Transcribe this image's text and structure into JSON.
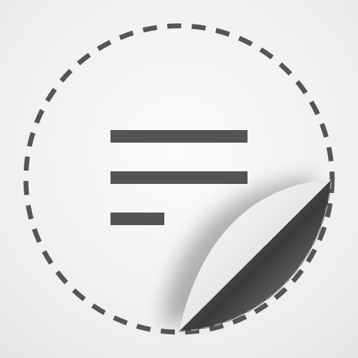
{
  "app_icon": {
    "icon_name": "sticker-notes-icon",
    "colors": {
      "background": "#f1f1f1",
      "dash": "#555555",
      "lines": "#545454",
      "peel_light": "#e4e4e4",
      "peel_dark": "#3c3c3c"
    }
  }
}
